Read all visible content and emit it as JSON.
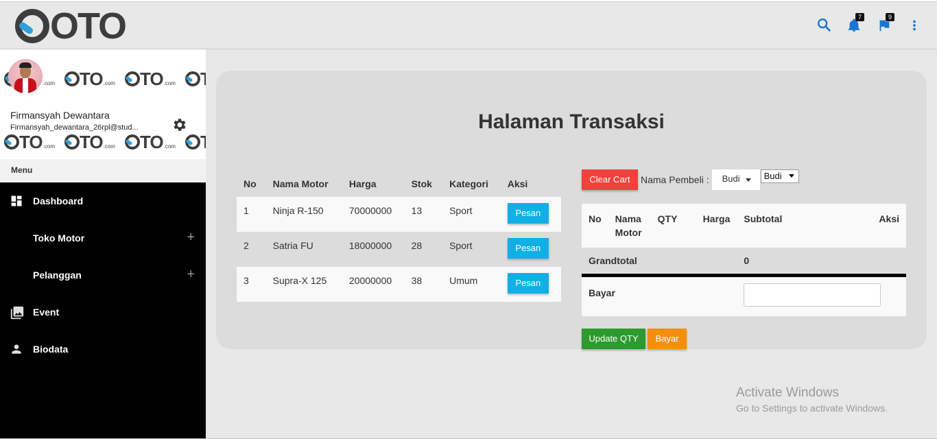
{
  "header": {
    "logo_text": "OTO",
    "notifications_count": "7",
    "flags_count": "9"
  },
  "sidebar": {
    "pattern_logo": "OTO",
    "pattern_suffix": ".com",
    "user_name": "Firmansyah Dewantara",
    "user_email": "Firmansyah_dewantara_26rpl@stud...",
    "menu_label": "Menu",
    "items": [
      {
        "label": "Dashboard",
        "icon": "dashboard-icon",
        "expandable": false
      },
      {
        "label": "Toko Motor",
        "icon": "",
        "expandable": true
      },
      {
        "label": "Pelanggan",
        "icon": "",
        "expandable": true
      },
      {
        "label": "Event",
        "icon": "photo-library-icon",
        "expandable": false
      },
      {
        "label": "Biodata",
        "icon": "person-icon",
        "expandable": false
      }
    ],
    "expand_symbol": "+"
  },
  "main": {
    "title": "Halaman Transaksi",
    "products": {
      "columns": [
        "No",
        "Nama Motor",
        "Harga",
        "Stok",
        "Kategori",
        "Aksi"
      ],
      "rows": [
        {
          "no": "1",
          "nama": "Ninja R-150",
          "harga": "70000000",
          "stok": "13",
          "kategori": "Sport",
          "aksi": "Pesan"
        },
        {
          "no": "2",
          "nama": "Satria FU",
          "harga": "18000000",
          "stok": "28",
          "kategori": "Sport",
          "aksi": "Pesan"
        },
        {
          "no": "3",
          "nama": "Supra-X 125",
          "harga": "20000000",
          "stok": "38",
          "kategori": "Umum",
          "aksi": "Pesan"
        }
      ]
    },
    "cart": {
      "clear_label": "Clear Cart",
      "pembeli_label": "Nama Pembeli :",
      "pembeli_dropdown": "Budi",
      "pembeli_select": "Budi",
      "columns": [
        "No",
        "Nama Motor",
        "QTY",
        "Harga",
        "Subtotal",
        "Aksi"
      ],
      "grandtotal_label": "Grandtotal",
      "grandtotal_value": "0",
      "bayar_label": "Bayar",
      "bayar_value": "",
      "update_label": "Update QTY",
      "bayar_button": "Bayar"
    }
  },
  "watermark": {
    "line1": "Activate Windows",
    "line2": "Go to Settings to activate Windows."
  },
  "colors": {
    "accent_blue": "#0fb0e6",
    "danger": "#f0413b",
    "success": "#2c9a2c",
    "warning": "#f58f0a",
    "icon_blue": "#1976d2"
  }
}
